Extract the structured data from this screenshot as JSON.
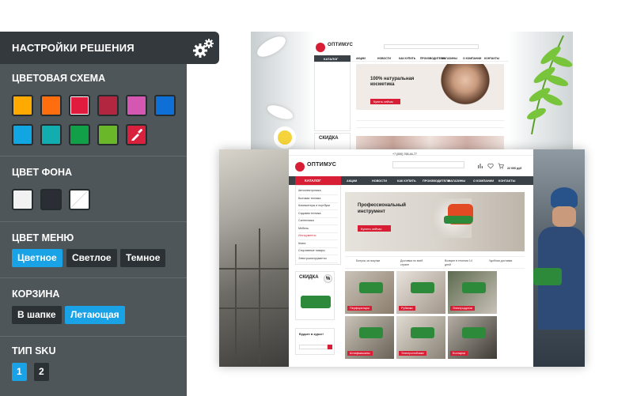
{
  "panel": {
    "title": "НАСТРОЙКИ РЕШЕНИЯ",
    "gear_icon": "gears-icon",
    "color_scheme": {
      "title": "ЦВЕТОВАЯ СХЕМА",
      "swatches": [
        "#ffaa00",
        "#ff6e0e",
        "#e01b3d",
        "#b3263f",
        "#d458b2",
        "#0e6fd6",
        "#11a6e2",
        "#12adae",
        "#11a047",
        "#6bb72a",
        "#d7213d"
      ],
      "picker_icon": "eyedropper-icon"
    },
    "background": {
      "title": "ЦВЕТ ФОНА",
      "swatches": [
        "#f2f2f2",
        "#2a2d33",
        "#ffffff"
      ]
    },
    "menu_color": {
      "title": "ЦВЕТ МЕНЮ",
      "options": [
        "Цветное",
        "Светлое",
        "Темное"
      ],
      "selected": "Цветное"
    },
    "cart": {
      "title": "КОРЗИНА",
      "options": [
        "В шапке",
        "Летающая"
      ],
      "selected": "Летающая"
    },
    "sku": {
      "title": "ТИП SKU",
      "options": [
        "1",
        "2"
      ],
      "selected": "1"
    }
  },
  "preview_top": {
    "logo": "ОПТИМУС",
    "menu": [
      "АКЦИИ",
      "НОВОСТИ",
      "КАК КУПИТЬ",
      "ПРОИЗВОДИТЕЛИ",
      "МАГАЗИНЫ",
      "О КОМПАНИИ",
      "КОНТАКТЫ"
    ],
    "catalog": "КАТАЛОГ",
    "banner": "100% натуральная косметика",
    "banner_button": "Купить сейчас",
    "sale": "СКИДКА"
  },
  "preview_main": {
    "logo": "ОПТИМУС",
    "phone": "+7 (000) 765-44-77",
    "cart_sum": "22 000 руб",
    "catalog": "КАТАЛОГ",
    "menu": [
      "АКЦИИ",
      "НОВОСТИ",
      "КАК КУПИТЬ",
      "ПРОИЗВОДИТЕЛИ",
      "МАГАЗИНЫ",
      "О КОМПАНИИ",
      "КОНТАКТЫ"
    ],
    "side_items": [
      "Автоэлектроника",
      "Бытовая техника",
      "Компьютеры и ноутбуки",
      "Садовая техника",
      "Сантехника",
      "Мебель",
      "Инструменты",
      "Книги",
      "Спортивные товары",
      "Электроинструменты"
    ],
    "active_side": "Инструменты",
    "banner_title": "Профессиональный инструмент",
    "banner_button": "Купить сейчас",
    "features": [
      "Бонусы за покупки",
      "Доставка по всей стране",
      "Возврат в течении 14 дней",
      "Удобная доставка"
    ],
    "sale": "СКИДКА",
    "sale_pct": "%",
    "subscribe": "Будьте в курсе!",
    "tiles": [
      "Перфораторы",
      "Рубанки",
      "Электродрели",
      "Шлифмашины",
      "Электролобзики",
      "Болгарки"
    ]
  }
}
